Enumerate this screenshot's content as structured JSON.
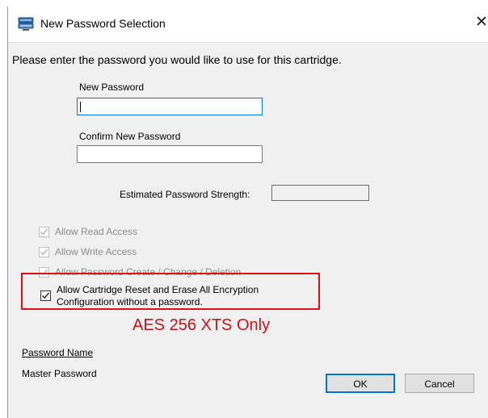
{
  "window": {
    "title": "New Password Selection",
    "close_glyph": "✕"
  },
  "instruction": "Please enter the password you would like to use for this cartridge.",
  "new_password": {
    "label": "New Password",
    "value": ""
  },
  "confirm_password": {
    "label": "Confirm New Password",
    "value": ""
  },
  "strength": {
    "label": "Estimated Password Strength:",
    "value": ""
  },
  "permissions": [
    {
      "label": "Allow Read Access",
      "checked": true,
      "enabled": false
    },
    {
      "label": "Allow Write Access",
      "checked": true,
      "enabled": false
    },
    {
      "label": "Allow Password Create / Change / Deletion",
      "checked": true,
      "enabled": false
    }
  ],
  "reset_option": {
    "line1": "Allow Cartridge Reset and Erase All Encryption",
    "line2": "Configuration without a password.",
    "checked": true,
    "enabled": true
  },
  "annotation": {
    "text": "AES 256 XTS Only",
    "color": "#d01018"
  },
  "password_name": {
    "label": "Password Name",
    "value": "Master Password"
  },
  "buttons": {
    "ok": "OK",
    "cancel": "Cancel"
  },
  "colors": {
    "focus_accent": "#0078d7",
    "highlight_border": "#e0101a",
    "dialog_bg": "#f0f0f0"
  },
  "icons": {
    "app": "drive-network-icon",
    "close": "close-icon",
    "check": "checkmark-icon"
  }
}
